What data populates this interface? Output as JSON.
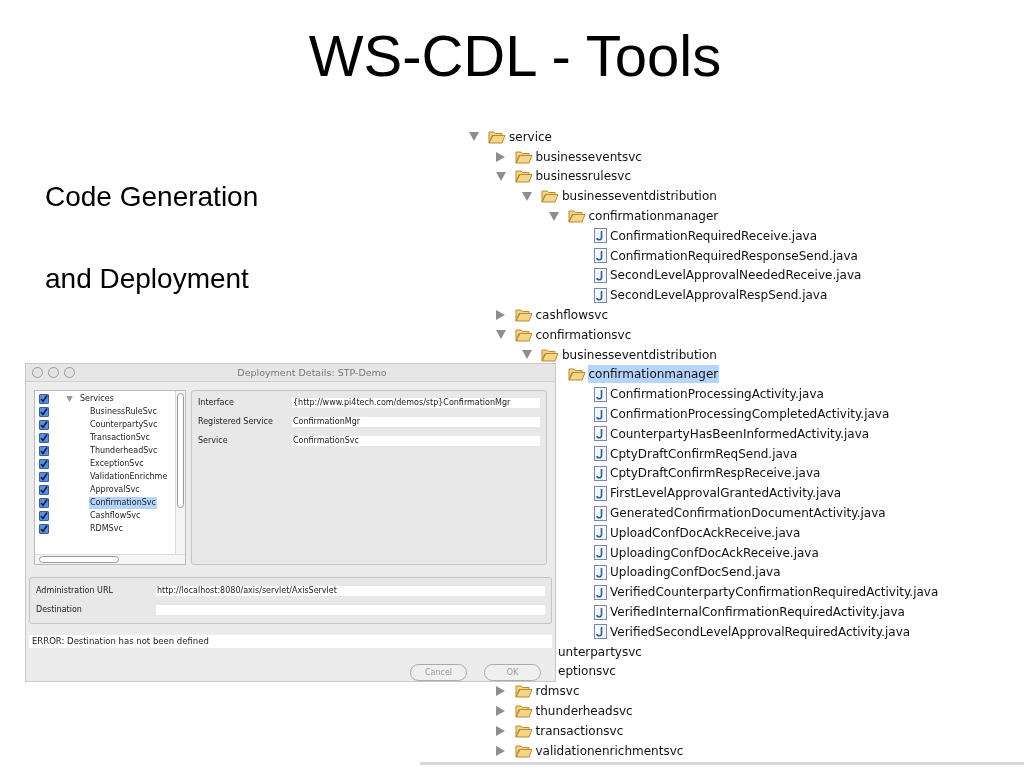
{
  "slide": {
    "title": "WS-CDL - Tools",
    "bullets": [
      "Code Generation",
      "and Deployment"
    ]
  },
  "project_tree": [
    {
      "label": "service",
      "kind": "folder",
      "expanded": true,
      "selected": false,
      "children": [
        {
          "label": "businesseventsvc",
          "kind": "folder",
          "expanded": false,
          "selected": false
        },
        {
          "label": "businessrulesvc",
          "kind": "folder",
          "expanded": true,
          "selected": false,
          "children": [
            {
              "label": "businesseventdistribution",
              "kind": "folder",
              "expanded": true,
              "selected": false,
              "children": [
                {
                  "label": "confirmationmanager",
                  "kind": "folder",
                  "expanded": true,
                  "selected": false,
                  "children": [
                    {
                      "label": "ConfirmationRequiredReceive.java",
                      "kind": "file",
                      "selected": false
                    },
                    {
                      "label": "ConfirmationRequiredResponseSend.java",
                      "kind": "file",
                      "selected": false
                    },
                    {
                      "label": "SecondLevelApprovalNeededReceive.java",
                      "kind": "file",
                      "selected": false
                    },
                    {
                      "label": "SecondLevelApprovalRespSend.java",
                      "kind": "file",
                      "selected": false
                    }
                  ]
                }
              ]
            }
          ]
        },
        {
          "label": "cashflowsvc",
          "kind": "folder",
          "expanded": false,
          "selected": false
        },
        {
          "label": "confirmationsvc",
          "kind": "folder",
          "expanded": true,
          "selected": false,
          "children": [
            {
              "label": "businesseventdistribution",
              "kind": "folder",
              "expanded": true,
              "selected": false,
              "children": [
                {
                  "label": "confirmationmanager",
                  "kind": "folder",
                  "selected": true,
                  "children": [
                    {
                      "label": "ConfirmationProcessingActivity.java",
                      "kind": "file",
                      "selected": false
                    },
                    {
                      "label": "ConfirmationProcessingCompletedActivity.java",
                      "kind": "file",
                      "selected": false
                    },
                    {
                      "label": "CounterpartyHasBeenInformedActivity.java",
                      "kind": "file",
                      "selected": false
                    },
                    {
                      "label": "CptyDraftConfirmReqSend.java",
                      "kind": "file",
                      "selected": false
                    },
                    {
                      "label": "CptyDraftConfirmRespReceive.java",
                      "kind": "file",
                      "selected": false
                    },
                    {
                      "label": "FirstLevelApprovalGrantedActivity.java",
                      "kind": "file",
                      "selected": false
                    },
                    {
                      "label": "GeneratedConfirmationDocumentActivity.java",
                      "kind": "file",
                      "selected": false
                    },
                    {
                      "label": "UploadConfDocAckReceive.java",
                      "kind": "file",
                      "selected": false
                    },
                    {
                      "label": "UploadingConfDocAckReceive.java",
                      "kind": "file",
                      "selected": false
                    },
                    {
                      "label": "UploadingConfDocSend.java",
                      "kind": "file",
                      "selected": false
                    },
                    {
                      "label": "VerifiedCounterpartyConfirmationRequiredActivity.java",
                      "kind": "file",
                      "selected": false
                    },
                    {
                      "label": "VerifiedInternalConfirmationRequiredActivity.java",
                      "kind": "file",
                      "selected": false
                    },
                    {
                      "label": "VerifiedSecondLevelApprovalRequiredActivity.java",
                      "kind": "file",
                      "selected": false
                    }
                  ]
                }
              ]
            }
          ]
        },
        {
          "label": "unterpartysvc",
          "kind": "cut",
          "selected": false
        },
        {
          "label": "eptionsvc",
          "kind": "cut",
          "selected": false
        },
        {
          "label": "rdmsvc",
          "kind": "folder",
          "expanded": false,
          "selected": false
        },
        {
          "label": "thunderheadsvc",
          "kind": "folder",
          "expanded": false,
          "selected": false
        },
        {
          "label": "transactionsvc",
          "kind": "folder",
          "expanded": false,
          "selected": false
        },
        {
          "label": "validationenrichmentsvc",
          "kind": "folder",
          "expanded": false,
          "selected": false
        }
      ]
    }
  ],
  "dialog": {
    "title": "Deployment Details: STP-Demo",
    "services": {
      "label": "Services",
      "expanded": true,
      "checked": true,
      "items": [
        {
          "label": "BusinessRuleSvc",
          "checked": true,
          "selected": false
        },
        {
          "label": "CounterpartySvc",
          "checked": true,
          "selected": false
        },
        {
          "label": "TransactionSvc",
          "checked": true,
          "selected": false
        },
        {
          "label": "ThunderheadSvc",
          "checked": true,
          "selected": false
        },
        {
          "label": "ExceptionSvc",
          "checked": true,
          "selected": false
        },
        {
          "label": "ValidationEnrichme",
          "checked": true,
          "selected": false
        },
        {
          "label": "ApprovalSvc",
          "checked": true,
          "selected": false
        },
        {
          "label": "ConfirmationSvc",
          "checked": true,
          "selected": true
        },
        {
          "label": "CashflowSvc",
          "checked": true,
          "selected": false
        },
        {
          "label": "RDMSvc",
          "checked": true,
          "selected": false
        }
      ]
    },
    "details": [
      {
        "label": "Interface",
        "value": "{http://www.pi4tech.com/demos/stp}ConfirmationMgr"
      },
      {
        "label": "Registered Service",
        "value": "ConfirmationMgr"
      },
      {
        "label": "Service",
        "value": "ConfirmationSvc"
      }
    ],
    "deployment": [
      {
        "label": "Administration URL",
        "value": "http://localhost:8080/axis/servlet/AxisServlet"
      },
      {
        "label": "Destination"
      }
    ],
    "error": "ERROR: Destination has not been defined",
    "buttons": [
      {
        "label": "Cancel",
        "disabled": true
      },
      {
        "label": "OK",
        "disabled": true
      }
    ]
  }
}
